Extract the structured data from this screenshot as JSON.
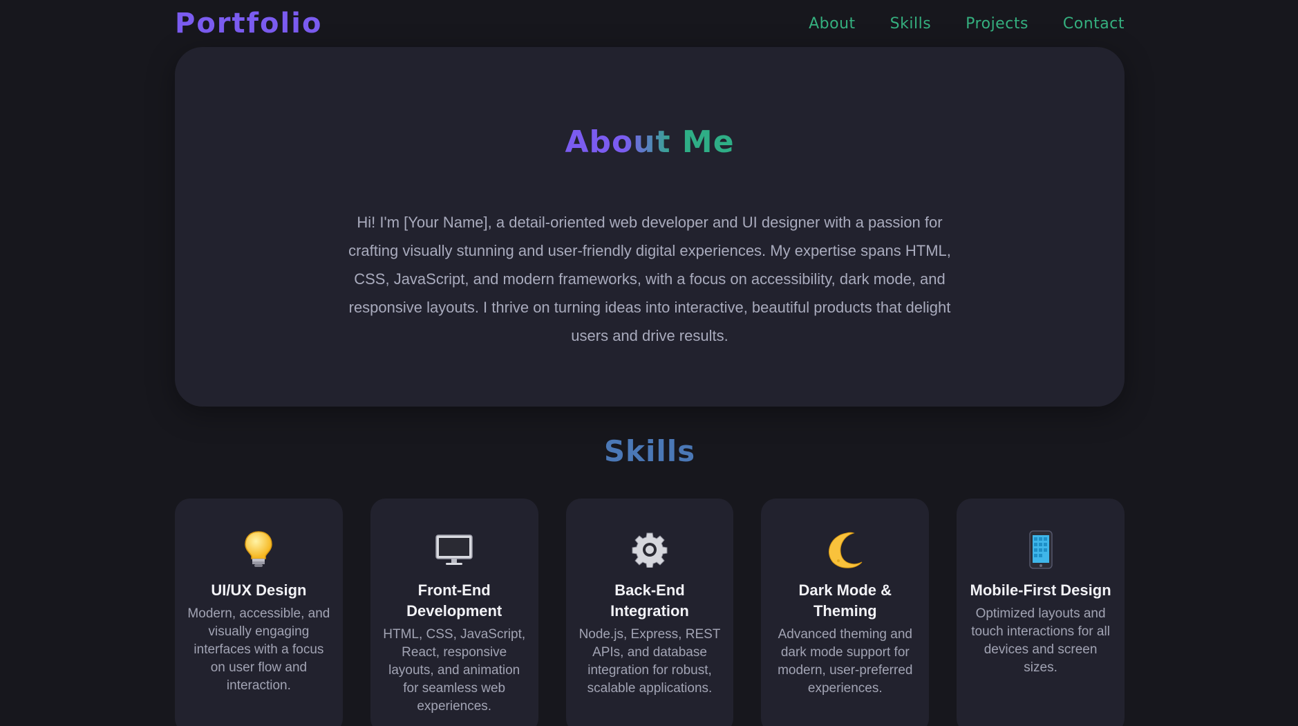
{
  "header": {
    "brand": "Portfolio",
    "nav": [
      "About",
      "Skills",
      "Projects",
      "Contact"
    ]
  },
  "about": {
    "title": "About Me",
    "body": "Hi! I'm [Your Name], a detail-oriented web developer and UI designer with a passion for crafting visually stunning and user-friendly digital experiences. My expertise spans HTML, CSS, JavaScript, and modern frameworks, with a focus on accessibility, dark mode, and responsive layouts. I thrive on turning ideas into interactive, beautiful products that delight users and drive results."
  },
  "skills": {
    "title": "Skills",
    "cards": [
      {
        "icon": "lightbulb-icon",
        "title": "UI/UX Design",
        "desc": "Modern, accessible, and visually engaging interfaces with a focus on user flow and interaction."
      },
      {
        "icon": "monitor-icon",
        "title": "Front-End Development",
        "desc": "HTML, CSS, JavaScript, React, responsive layouts, and animation for seamless web experiences."
      },
      {
        "icon": "gear-icon",
        "title": "Back-End Integration",
        "desc": "Node.js, Express, REST APIs, and database integration for robust, scalable applications."
      },
      {
        "icon": "crescent-moon-icon",
        "title": "Dark Mode & Theming",
        "desc": "Advanced theming and dark mode support for modern, user-preferred experiences."
      },
      {
        "icon": "mobile-phone-icon",
        "title": "Mobile-First Design",
        "desc": "Optimized layouts and touch interactions for all devices and screen sizes."
      }
    ]
  },
  "colors": {
    "background": "#17171d",
    "card": "#22222e",
    "brand_purple": "#7b5cf0",
    "nav_green": "#35b07f",
    "skills_blue": "#4b78b6"
  }
}
